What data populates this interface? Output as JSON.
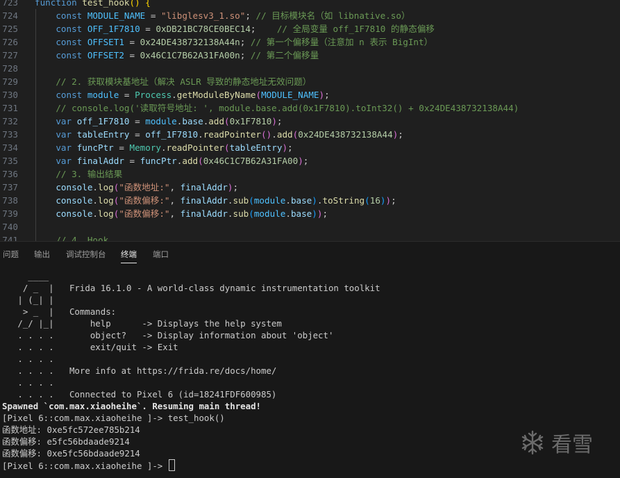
{
  "editor": {
    "lines": [
      {
        "num": "723",
        "tokens": [
          [
            "kw",
            "function "
          ],
          [
            "fn",
            "test_hook"
          ],
          [
            "br1",
            "()"
          ],
          [
            "pn",
            " "
          ],
          [
            "br1",
            "{"
          ]
        ]
      },
      {
        "num": "724",
        "tokens": [
          [
            "pn",
            "    "
          ],
          [
            "kw",
            "const "
          ],
          [
            "cst",
            "MODULE_NAME"
          ],
          [
            "pn",
            " = "
          ],
          [
            "str",
            "\"libglesv3_1.so\""
          ],
          [
            "pn",
            "; "
          ],
          [
            "cm",
            "// 目标模块名（如 libnative.so）"
          ]
        ]
      },
      {
        "num": "725",
        "tokens": [
          [
            "pn",
            "    "
          ],
          [
            "kw",
            "const "
          ],
          [
            "cst",
            "OFF_1F7810"
          ],
          [
            "pn",
            " = "
          ],
          [
            "num",
            "0xDB21BC78CE0BEC14"
          ],
          [
            "pn",
            ";    "
          ],
          [
            "cm",
            "// 全局变量 off_1F7810 的静态偏移"
          ]
        ]
      },
      {
        "num": "726",
        "tokens": [
          [
            "pn",
            "    "
          ],
          [
            "kw",
            "const "
          ],
          [
            "cst",
            "OFFSET1"
          ],
          [
            "pn",
            " = "
          ],
          [
            "num",
            "0x24DE438732138A44n"
          ],
          [
            "pn",
            "; "
          ],
          [
            "cm",
            "// 第一个偏移量（注意加 n 表示 BigInt）"
          ]
        ]
      },
      {
        "num": "727",
        "tokens": [
          [
            "pn",
            "    "
          ],
          [
            "kw",
            "const "
          ],
          [
            "cst",
            "OFFSET2"
          ],
          [
            "pn",
            " = "
          ],
          [
            "num",
            "0x46C1C7B62A31FA00n"
          ],
          [
            "pn",
            "; "
          ],
          [
            "cm",
            "// 第二个偏移量"
          ]
        ]
      },
      {
        "num": "728",
        "tokens": []
      },
      {
        "num": "729",
        "tokens": [
          [
            "pn",
            "    "
          ],
          [
            "cm",
            "// 2. 获取模块基地址（解决 ASLR 导致的静态地址无效问题）"
          ]
        ]
      },
      {
        "num": "730",
        "tokens": [
          [
            "pn",
            "    "
          ],
          [
            "kw",
            "const "
          ],
          [
            "cst",
            "module"
          ],
          [
            "pn",
            " = "
          ],
          [
            "cls",
            "Process"
          ],
          [
            "pn",
            "."
          ],
          [
            "fn",
            "getModuleByName"
          ],
          [
            "br2",
            "("
          ],
          [
            "cst",
            "MODULE_NAME"
          ],
          [
            "br2",
            ")"
          ],
          [
            "pn",
            ";"
          ]
        ]
      },
      {
        "num": "731",
        "tokens": [
          [
            "pn",
            "    "
          ],
          [
            "cm",
            "// console.log('读取符号地址: ', module.base.add(0x1F7810).toInt32() + 0x24DE438732138A44)"
          ]
        ]
      },
      {
        "num": "732",
        "tokens": [
          [
            "pn",
            "    "
          ],
          [
            "kw",
            "var "
          ],
          [
            "var",
            "off_1F7810"
          ],
          [
            "pn",
            " = "
          ],
          [
            "cst",
            "module"
          ],
          [
            "pn",
            "."
          ],
          [
            "var",
            "base"
          ],
          [
            "pn",
            "."
          ],
          [
            "fn",
            "add"
          ],
          [
            "br2",
            "("
          ],
          [
            "num",
            "0x1F7810"
          ],
          [
            "br2",
            ")"
          ],
          [
            "pn",
            ";"
          ]
        ]
      },
      {
        "num": "733",
        "tokens": [
          [
            "pn",
            "    "
          ],
          [
            "kw",
            "var "
          ],
          [
            "var",
            "tableEntry"
          ],
          [
            "pn",
            " = "
          ],
          [
            "var",
            "off_1F7810"
          ],
          [
            "pn",
            "."
          ],
          [
            "fn",
            "readPointer"
          ],
          [
            "br2",
            "()"
          ],
          [
            "pn",
            "."
          ],
          [
            "fn",
            "add"
          ],
          [
            "br2",
            "("
          ],
          [
            "num",
            "0x24DE438732138A44"
          ],
          [
            "br2",
            ")"
          ],
          [
            "pn",
            ";"
          ]
        ]
      },
      {
        "num": "734",
        "tokens": [
          [
            "pn",
            "    "
          ],
          [
            "kw",
            "var "
          ],
          [
            "var",
            "funcPtr"
          ],
          [
            "pn",
            " = "
          ],
          [
            "cls",
            "Memory"
          ],
          [
            "pn",
            "."
          ],
          [
            "fn",
            "readPointer"
          ],
          [
            "br2",
            "("
          ],
          [
            "var",
            "tableEntry"
          ],
          [
            "br2",
            ")"
          ],
          [
            "pn",
            ";"
          ]
        ]
      },
      {
        "num": "735",
        "tokens": [
          [
            "pn",
            "    "
          ],
          [
            "kw",
            "var "
          ],
          [
            "var",
            "finalAddr"
          ],
          [
            "pn",
            " = "
          ],
          [
            "var",
            "funcPtr"
          ],
          [
            "pn",
            "."
          ],
          [
            "fn",
            "add"
          ],
          [
            "br2",
            "("
          ],
          [
            "num",
            "0x46C1C7B62A31FA00"
          ],
          [
            "br2",
            ")"
          ],
          [
            "pn",
            ";"
          ]
        ]
      },
      {
        "num": "736",
        "tokens": [
          [
            "pn",
            "    "
          ],
          [
            "cm",
            "// 3. 输出结果"
          ]
        ]
      },
      {
        "num": "737",
        "tokens": [
          [
            "pn",
            "    "
          ],
          [
            "var",
            "console"
          ],
          [
            "pn",
            "."
          ],
          [
            "fn",
            "log"
          ],
          [
            "br2",
            "("
          ],
          [
            "str",
            "\"函数地址:\""
          ],
          [
            "pn",
            ", "
          ],
          [
            "var",
            "finalAddr"
          ],
          [
            "br2",
            ")"
          ],
          [
            "pn",
            ";"
          ]
        ]
      },
      {
        "num": "738",
        "tokens": [
          [
            "pn",
            "    "
          ],
          [
            "var",
            "console"
          ],
          [
            "pn",
            "."
          ],
          [
            "fn",
            "log"
          ],
          [
            "br2",
            "("
          ],
          [
            "str",
            "\"函数偏移:\""
          ],
          [
            "pn",
            ", "
          ],
          [
            "var",
            "finalAddr"
          ],
          [
            "pn",
            "."
          ],
          [
            "fn",
            "sub"
          ],
          [
            "br3",
            "("
          ],
          [
            "cst",
            "module"
          ],
          [
            "pn",
            "."
          ],
          [
            "var",
            "base"
          ],
          [
            "br3",
            ")"
          ],
          [
            "pn",
            "."
          ],
          [
            "fn",
            "toString"
          ],
          [
            "br3",
            "("
          ],
          [
            "num",
            "16"
          ],
          [
            "br3",
            ")"
          ],
          [
            "br2",
            ")"
          ],
          [
            "pn",
            ";"
          ]
        ]
      },
      {
        "num": "739",
        "tokens": [
          [
            "pn",
            "    "
          ],
          [
            "var",
            "console"
          ],
          [
            "pn",
            "."
          ],
          [
            "fn",
            "log"
          ],
          [
            "br2",
            "("
          ],
          [
            "str",
            "\"函数偏移:\""
          ],
          [
            "pn",
            ", "
          ],
          [
            "var",
            "finalAddr"
          ],
          [
            "pn",
            "."
          ],
          [
            "fn",
            "sub"
          ],
          [
            "br3",
            "("
          ],
          [
            "cst",
            "module"
          ],
          [
            "pn",
            "."
          ],
          [
            "var",
            "base"
          ],
          [
            "br3",
            ")"
          ],
          [
            "br2",
            ")"
          ],
          [
            "pn",
            ";"
          ]
        ]
      },
      {
        "num": "740",
        "tokens": []
      },
      {
        "num": "741",
        "tokens": [
          [
            "pn",
            "    "
          ],
          [
            "cm",
            "// 4. Hook"
          ]
        ]
      }
    ]
  },
  "panel": {
    "tabs": [
      {
        "label": "问题",
        "active": false
      },
      {
        "label": "输出",
        "active": false
      },
      {
        "label": "调试控制台",
        "active": false
      },
      {
        "label": "终端",
        "active": true
      },
      {
        "label": "端口",
        "active": false
      }
    ]
  },
  "terminal": {
    "lines": [
      {
        "text": "     ____",
        "bold": false
      },
      {
        "text": "    / _  |   Frida 16.1.0 - A world-class dynamic instrumentation toolkit",
        "bold": false
      },
      {
        "text": "   | (_| |",
        "bold": false
      },
      {
        "text": "    > _  |   Commands:",
        "bold": false
      },
      {
        "text": "   /_/ |_|       help      -> Displays the help system",
        "bold": false
      },
      {
        "text": "   . . . .       object?   -> Display information about 'object'",
        "bold": false
      },
      {
        "text": "   . . . .       exit/quit -> Exit",
        "bold": false
      },
      {
        "text": "   . . . .",
        "bold": false
      },
      {
        "text": "   . . . .   More info at https://frida.re/docs/home/",
        "bold": false
      },
      {
        "text": "   . . . .",
        "bold": false
      },
      {
        "text": "   . . . .   Connected to Pixel 6 (id=18241FDF600985)",
        "bold": false
      },
      {
        "text": "Spawned `com.max.xiaoheihe`. Resuming main thread!",
        "bold": true
      },
      {
        "text": "[Pixel 6::com.max.xiaoheihe ]-> test_hook()",
        "bold": false
      },
      {
        "text": "函数地址: 0xe5fc572ee785b214",
        "bold": false
      },
      {
        "text": "函数偏移: e5fc56bdaade9214",
        "bold": false
      },
      {
        "text": "函数偏移: 0xe5fc56bdaade9214",
        "bold": false
      },
      {
        "text": "[Pixel 6::com.max.xiaoheihe ]-> ",
        "bold": false,
        "cursor": true
      }
    ]
  },
  "watermark": {
    "text": "看雪",
    "icon": "snowflake-icon",
    "color": "#6b6b6b"
  }
}
